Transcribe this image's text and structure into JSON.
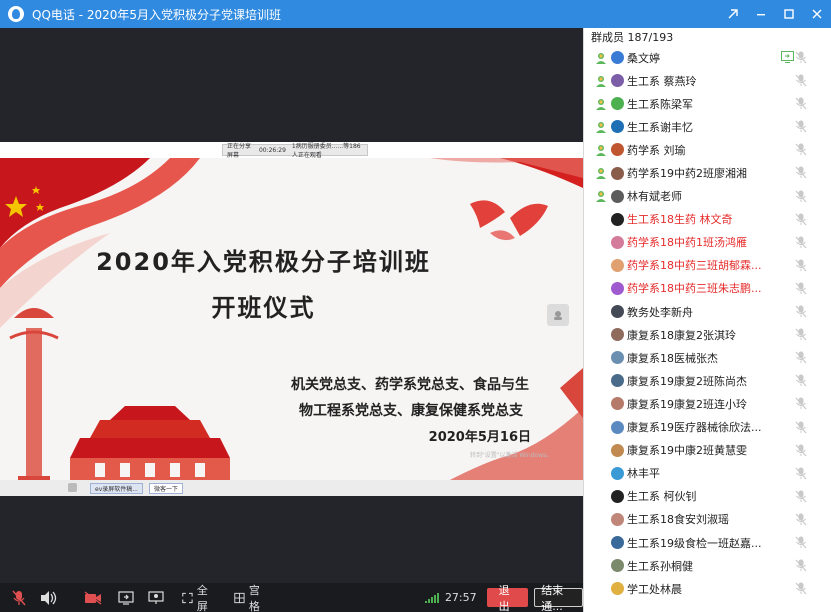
{
  "window": {
    "title": "QQ电话 - 2020年5月入党积极分子党课培训班",
    "buttons": [
      "minimize",
      "restore",
      "maximize",
      "close"
    ]
  },
  "share_bar": {
    "status": "正在分享屏幕",
    "time": "00:26:29",
    "viewers": "1病历服册委员......等186人正在观看"
  },
  "slide": {
    "title_line1": "2020年入党积极分子培训班",
    "title_line2": "开班仪式",
    "org_line1": "机关党总支、药学系党总支、食品与生",
    "org_line2": "物工程系党总支、康复保健系党总支",
    "date": "2020年5月16日",
    "watermark": "转到\"设置\"以激活 Windows。",
    "taskbar_app": "ev录屏软件稿...",
    "taskbar_btn": "微客一下"
  },
  "controls": {
    "fullscreen_label": "全屏",
    "grid_label": "宫格",
    "duration": "27:57",
    "exit_label": "退出",
    "end_label": "结束通..."
  },
  "panel": {
    "header": "群成员 187/193",
    "members": [
      {
        "name": "桑文婷",
        "status": true,
        "red": false,
        "screen": true,
        "avatar": "#3a7bd5"
      },
      {
        "name": "生工系 蔡燕玲",
        "status": true,
        "red": false,
        "screen": false,
        "avatar": "#7b5ea7"
      },
      {
        "name": "生工系陈梁军",
        "status": true,
        "red": false,
        "screen": false,
        "avatar": "#4caf50"
      },
      {
        "name": "生工系谢丰忆",
        "status": true,
        "red": false,
        "screen": false,
        "avatar": "#1f6fb5"
      },
      {
        "name": "药学系 刘瑜",
        "status": true,
        "red": false,
        "screen": false,
        "avatar": "#c0562f"
      },
      {
        "name": "药学系19中药2班廖湘湘",
        "status": true,
        "red": false,
        "screen": false,
        "avatar": "#8a5c4a"
      },
      {
        "name": "林有斌老师",
        "status": true,
        "red": false,
        "screen": false,
        "avatar": "#5c5c5c"
      },
      {
        "name": "生工系18生药 林文奇",
        "status": false,
        "red": true,
        "screen": false,
        "avatar": "#222222"
      },
      {
        "name": "药学系18中药1班汤鸿雁",
        "status": false,
        "red": true,
        "screen": false,
        "avatar": "#d47a9a"
      },
      {
        "name": "药学系18中药三班胡郁霖...",
        "status": false,
        "red": true,
        "screen": false,
        "avatar": "#e0a070"
      },
      {
        "name": "药学系18中药三班朱志鹏...",
        "status": false,
        "red": true,
        "screen": false,
        "avatar": "#a05ad0"
      },
      {
        "name": "教务处李新舟",
        "status": false,
        "red": false,
        "screen": false,
        "avatar": "#444a55"
      },
      {
        "name": "康复系18康复2张淇玲",
        "status": false,
        "red": false,
        "screen": false,
        "avatar": "#8e6b5c"
      },
      {
        "name": "康复系18医械张杰",
        "status": false,
        "red": false,
        "screen": false,
        "avatar": "#6a8fb0"
      },
      {
        "name": "康复系19康复2班陈尚杰",
        "status": false,
        "red": false,
        "screen": false,
        "avatar": "#4a6a8a"
      },
      {
        "name": "康复系19康复2班连小玲",
        "status": false,
        "red": false,
        "screen": false,
        "avatar": "#b57a6a"
      },
      {
        "name": "康复系19医疗器械徐欣法...",
        "status": false,
        "red": false,
        "screen": false,
        "avatar": "#5a8ac0"
      },
      {
        "name": "康复系19中康2班黄慧雯",
        "status": false,
        "red": false,
        "screen": false,
        "avatar": "#c08a50"
      },
      {
        "name": "林丰平",
        "status": false,
        "red": false,
        "screen": false,
        "avatar": "#3a9ad5"
      },
      {
        "name": "生工系 柯伙钊",
        "status": false,
        "red": false,
        "screen": false,
        "avatar": "#222222"
      },
      {
        "name": "生工系18食安刘淑瑶",
        "status": false,
        "red": false,
        "screen": false,
        "avatar": "#c0867a"
      },
      {
        "name": "生工系19级食检一班赵嘉...",
        "status": false,
        "red": false,
        "screen": false,
        "avatar": "#3a6a9a"
      },
      {
        "name": "生工系孙桐健",
        "status": false,
        "red": false,
        "screen": false,
        "avatar": "#7a8a6a"
      },
      {
        "name": "学工处林晨",
        "status": false,
        "red": false,
        "screen": false,
        "avatar": "#e0b040"
      }
    ]
  },
  "colors": {
    "titlebar": "#2f8ae0",
    "accent_red": "#e52b2b",
    "status_green": "#5cb85c",
    "mic_muted": "#c9c9c9"
  }
}
